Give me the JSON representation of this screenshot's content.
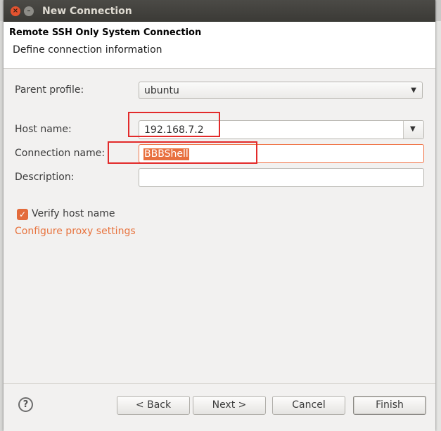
{
  "window": {
    "title": "New Connection"
  },
  "header": {
    "title": "Remote SSH Only System Connection",
    "description": "Define connection information"
  },
  "form": {
    "parent_profile": {
      "label": "Parent profile:",
      "value": "ubuntu"
    },
    "host_name": {
      "label": "Host name:",
      "value": "192.168.7.2"
    },
    "connection_name": {
      "label": "Connection name:",
      "value": "BBBShell"
    },
    "description": {
      "label": "Description:",
      "value": ""
    },
    "verify_host": {
      "label": "Verify host name",
      "checked": true
    },
    "proxy_link": "Configure proxy settings"
  },
  "buttons": {
    "help": "?",
    "back": "< Back",
    "next": "Next >",
    "cancel": "Cancel",
    "finish": "Finish"
  },
  "colors": {
    "accent": "#e8703f",
    "annotation": "#e22a2a"
  }
}
